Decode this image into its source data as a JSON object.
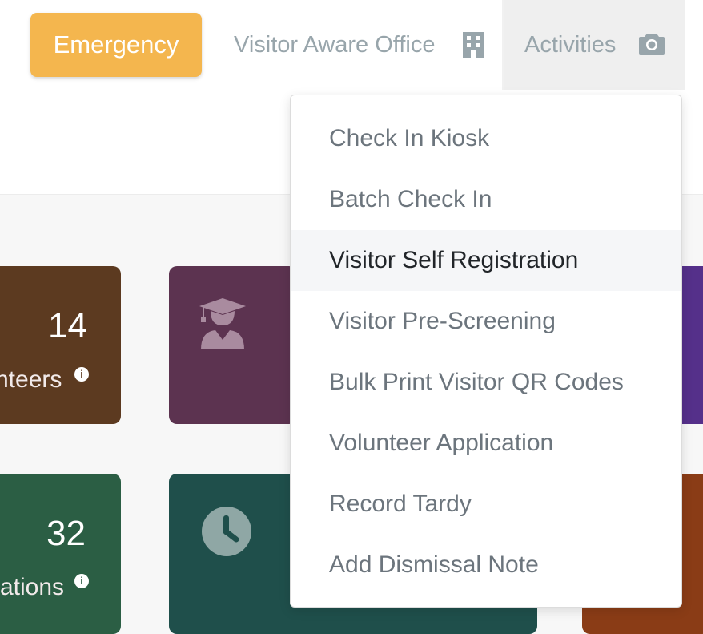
{
  "header": {
    "emergency_label": "Emergency",
    "office_label": "Visitor Aware Office",
    "office_icon": "building-icon",
    "activities_label": "Activities",
    "activities_icon": "camera-icon"
  },
  "activities_menu": {
    "items": [
      {
        "label": "Check In Kiosk"
      },
      {
        "label": "Batch Check In"
      },
      {
        "label": "Visitor Self Registration",
        "active": true
      },
      {
        "label": "Visitor Pre-Screening"
      },
      {
        "label": "Bulk Print Visitor QR Codes"
      },
      {
        "label": "Volunteer Application"
      },
      {
        "label": "Record Tardy"
      },
      {
        "label": "Add Dismissal Note"
      }
    ]
  },
  "cards": {
    "volunteers": {
      "count": "14",
      "label": "nteers",
      "color": "#5c3a20"
    },
    "students": {
      "icon": "graduate-icon",
      "color": "#5c3350"
    },
    "applications": {
      "count": "32",
      "label": "ations",
      "color": "#2b5e44"
    },
    "tardy": {
      "icon": "clock-icon",
      "color": "#1f4f4b"
    }
  },
  "colors": {
    "emergency": "#f4b64e",
    "nav_text": "#98a5ab",
    "menu_text": "#6c757d",
    "menu_active_text": "#212529"
  }
}
